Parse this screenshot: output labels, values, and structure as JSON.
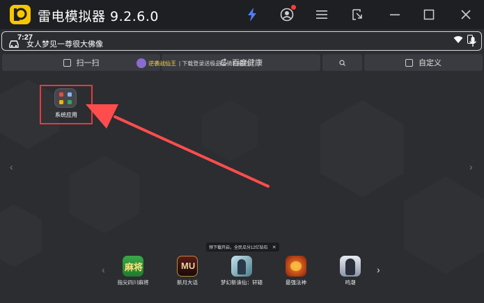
{
  "titlebar": {
    "app_title": "雷电模拟器 9.2.6.0",
    "icons": [
      "lightning-icon",
      "account-icon",
      "menu-icon",
      "minimize-to-side-icon",
      "minimize-icon",
      "maximize-icon",
      "close-icon"
    ],
    "accent": "#f7c600",
    "notification_dot": "#ff3b3b"
  },
  "statusbar": {
    "time": "7:27",
    "marquee": "女人梦见一尊很大佛像"
  },
  "toolrow": {
    "scan_label": "扫一扫",
    "search_label": "百度健康",
    "custom_label": "自定义",
    "promo_name": "逆袭战仙王",
    "promo_text": "| 下载登录送极品坐骑和福利"
  },
  "desktop": {
    "folder_label": "系统应用",
    "highlight_color": "#e63a3a"
  },
  "notice": {
    "text": "预下载开启，全民瓜分12亿钻石"
  },
  "dock": {
    "apps": [
      {
        "label": "指尖四川麻将",
        "badge": "麻将"
      },
      {
        "label": "新月大话",
        "badge": "MU"
      },
      {
        "label": "梦幻新诛仙：轩辕",
        "badge": ""
      },
      {
        "label": "最强法神",
        "badge": ""
      },
      {
        "label": "鸣潮",
        "badge": ""
      }
    ]
  }
}
